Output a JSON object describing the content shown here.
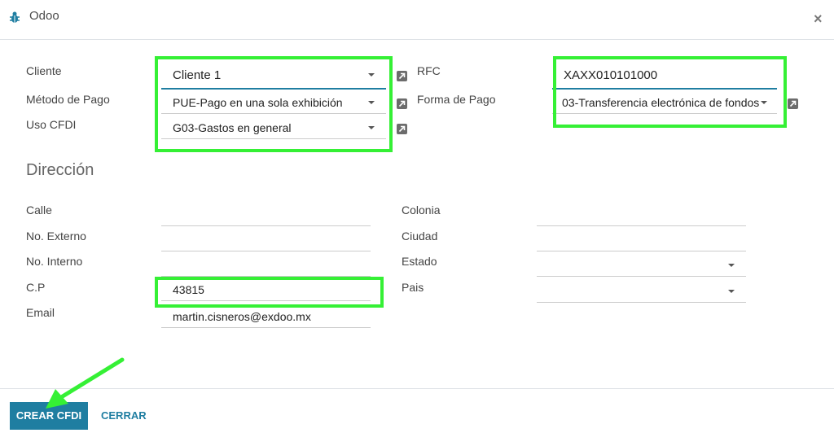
{
  "dialog": {
    "title": "Odoo",
    "close_glyph": "×",
    "icon": "bug-icon"
  },
  "form": {
    "cliente": {
      "label": "Cliente",
      "value": "Cliente 1"
    },
    "metodo_pago": {
      "label": "Método de Pago",
      "value": "PUE-Pago en una sola exhibición"
    },
    "uso_cfdi": {
      "label": "Uso CFDI",
      "value": "G03-Gastos en general"
    },
    "rfc": {
      "label": "RFC",
      "value": "XAXX010101000"
    },
    "forma_pago": {
      "label": "Forma de Pago",
      "value": "03-Transferencia electrónica de fondos"
    }
  },
  "address": {
    "title": "Dirección",
    "calle": {
      "label": "Calle",
      "value": ""
    },
    "no_externo": {
      "label": "No. Externo",
      "value": ""
    },
    "no_interno": {
      "label": "No. Interno",
      "value": ""
    },
    "cp": {
      "label": "C.P",
      "value": "43815"
    },
    "email": {
      "label": "Email",
      "value": "martin.cisneros@exdoo.mx"
    },
    "colonia": {
      "label": "Colonia",
      "value": ""
    },
    "ciudad": {
      "label": "Ciudad",
      "value": ""
    },
    "estado": {
      "label": "Estado",
      "value": ""
    },
    "pais": {
      "label": "Pais",
      "value": ""
    }
  },
  "footer": {
    "primary_label": "CREAR CFDI",
    "secondary_label": "CERRAR"
  },
  "colors": {
    "primary": "#1f7ea1",
    "highlight": "#35f035"
  }
}
